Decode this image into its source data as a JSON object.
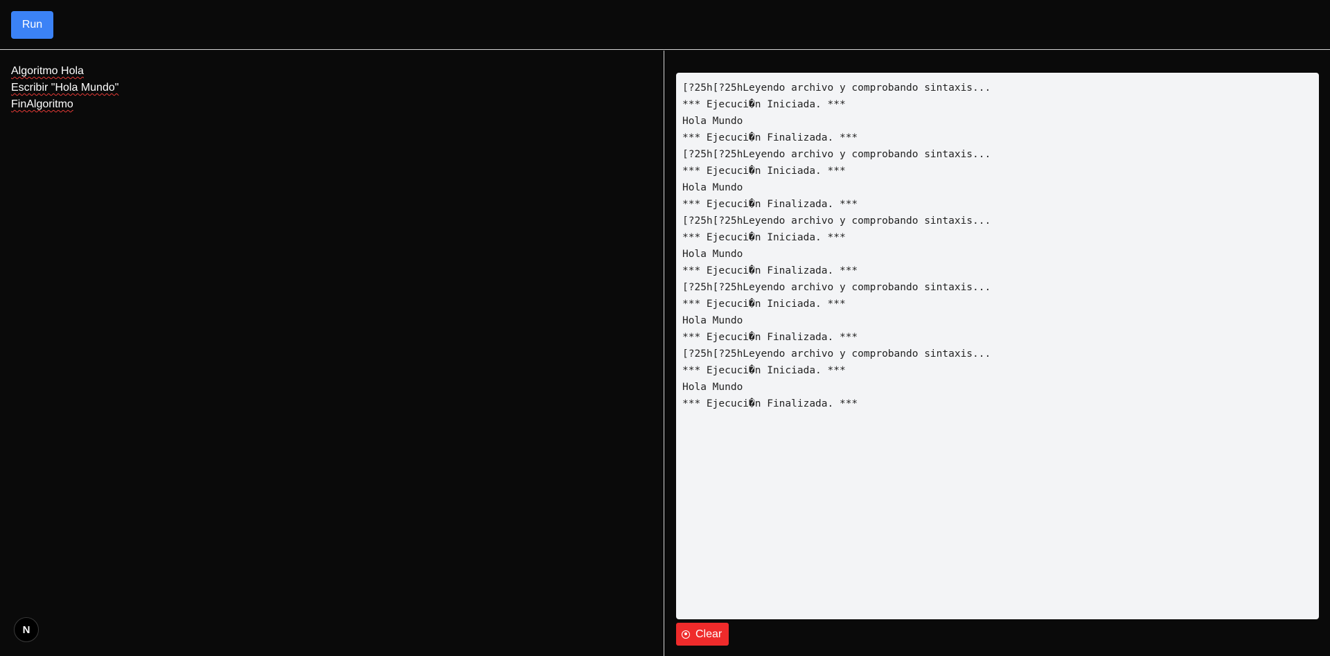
{
  "toolbar": {
    "run_label": "Run"
  },
  "editor": {
    "lines": [
      "Algoritmo Hola",
      "Escribir \"Hola Mundo\"",
      "FinAlgoritmo"
    ]
  },
  "console": {
    "lines": [
      "[?25h[?25hLeyendo archivo y comprobando sintaxis...",
      "*** Ejecuci�n Iniciada. ***",
      "Hola Mundo",
      "*** Ejecuci�n Finalizada. ***",
      "[?25h[?25hLeyendo archivo y comprobando sintaxis...",
      "*** Ejecuci�n Iniciada. ***",
      "Hola Mundo",
      "*** Ejecuci�n Finalizada. ***",
      "[?25h[?25hLeyendo archivo y comprobando sintaxis...",
      "*** Ejecuci�n Iniciada. ***",
      "Hola Mundo",
      "*** Ejecuci�n Finalizada. ***",
      "[?25h[?25hLeyendo archivo y comprobando sintaxis...",
      "*** Ejecuci�n Iniciada. ***",
      "Hola Mundo",
      "*** Ejecuci�n Finalizada. ***",
      "[?25h[?25hLeyendo archivo y comprobando sintaxis...",
      "*** Ejecuci�n Iniciada. ***",
      "Hola Mundo",
      "*** Ejecuci�n Finalizada. ***"
    ],
    "clear_label": "Clear",
    "clear_icon": "stop-circle-icon"
  },
  "badge": {
    "label": "N"
  },
  "colors": {
    "background": "#0a0a0a",
    "run_button": "#3b82f6",
    "clear_button": "#ef2b2b",
    "console_bg": "#f3f4f6"
  }
}
